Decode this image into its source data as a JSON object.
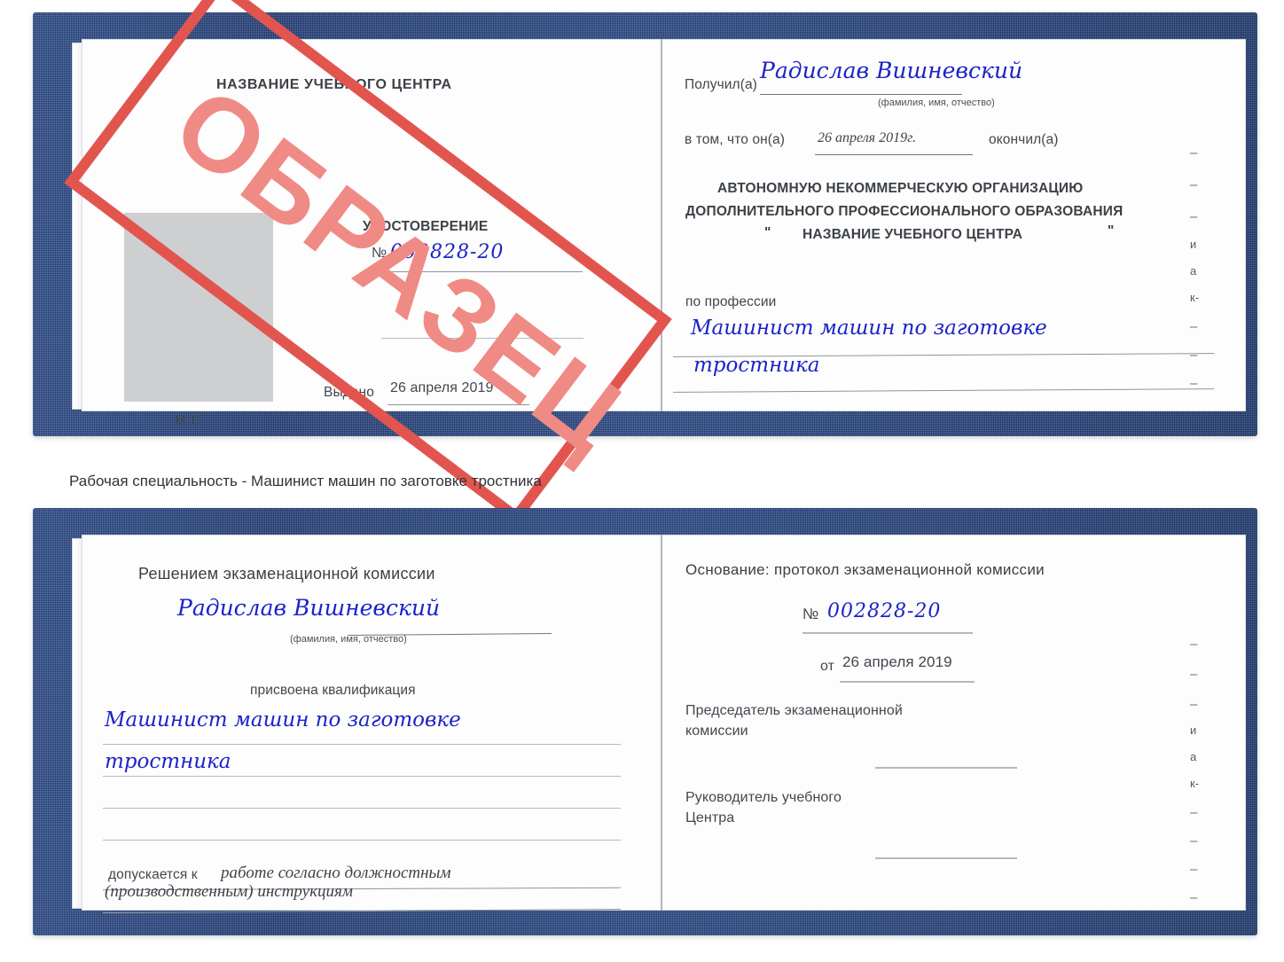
{
  "meta": {
    "accent_blue_cover": "#25427e",
    "ink_blue": "#1b23c8",
    "stamp_red": "#e2554f",
    "stamp_red_text": "#f08a84",
    "page_white": "#fdfdfd"
  },
  "watermark": {
    "text": "ОБРАЗЕЦ"
  },
  "caption": {
    "text": "Рабочая специальность - Машинист машин по заготовке тростника"
  },
  "certificate_top": {
    "left_page": {
      "center_name": "НАЗВАНИЕ УЧЕБНОГО ЦЕНТРА",
      "doc_title": "УДОСТОВЕРЕНИЕ",
      "number_symbol": "№",
      "number_value": "002828-20",
      "issued_label": "Выдано",
      "issued_value": "26 апреля 2019",
      "seal_label": "М.П."
    },
    "right_page": {
      "received_label": "Получил(а)",
      "received_value": "Радислав Вишневский",
      "fio_hint": "(фамилия, имя, отчество)",
      "in_that_label": "в том, что он(а)",
      "date_value": "26 апреля 2019г.",
      "finished_label": "окончил(а)",
      "org_line1": "АВТОНОМНУЮ НЕКОММЕРЧЕСКУЮ ОРГАНИЗАЦИЮ",
      "org_line2": "ДОПОЛНИТЕЛЬНОГО ПРОФЕССИОНАЛЬНОГО ОБРАЗОВАНИЯ",
      "org_quote_open": "\"",
      "org_line3": "НАЗВАНИЕ УЧЕБНОГО ЦЕНТРА",
      "org_quote_close": "\"",
      "profession_label": "по профессии",
      "profession_line1": "Машинист машин по заготовке",
      "profession_line2": "тростника",
      "margin_fragments": [
        "–",
        "–",
        "–",
        "и",
        "а",
        "к-",
        "–",
        "–",
        "–"
      ]
    }
  },
  "certificate_bottom": {
    "left_page": {
      "decision_title": "Решением экзаменационной комиссии",
      "name_value": "Радислав Вишневский",
      "fio_hint": "(фамилия, имя, отчество)",
      "qualification_label": "присвоена квалификация",
      "qualification_line1": "Машинист машин по заготовке",
      "qualification_line2": "тростника",
      "admitted_label": "допускается к",
      "admitted_value_line1": "работе согласно должностным",
      "admitted_value_line2": "(производственным) инструкциям"
    },
    "right_page": {
      "basis_label": "Основание: протокол экзаменационной комиссии",
      "number_symbol": "№",
      "number_value": "002828-20",
      "from_label": "от",
      "from_value": "26 апреля 2019",
      "chairman_line1": "Председатель экзаменационной",
      "chairman_line2": "комиссии",
      "director_line1": "Руководитель учебного",
      "director_line2": "Центра",
      "margin_fragments": [
        "–",
        "–",
        "–",
        "и",
        "а",
        "к-",
        "–",
        "–",
        "–",
        "–"
      ]
    }
  }
}
